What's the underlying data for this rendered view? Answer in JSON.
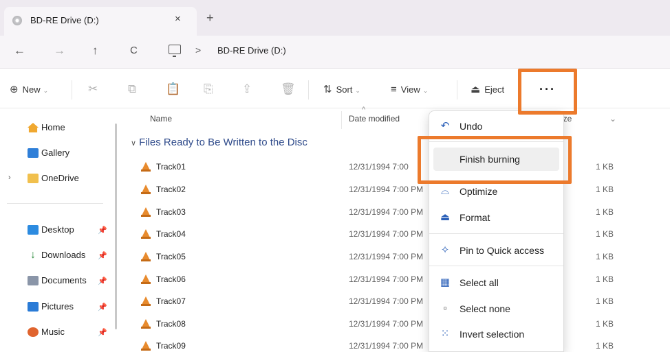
{
  "tab": {
    "title": "BD-RE Drive (D:)",
    "close_icon": "×",
    "new_tab_icon": "+"
  },
  "nav": {
    "back": "←",
    "forward": "→",
    "up": "↑",
    "refresh": "C",
    "separator": ">",
    "path": "BD-RE Drive (D:)"
  },
  "toolbar": {
    "new_label": "New",
    "sort_label": "Sort",
    "view_label": "View",
    "eject_label": "Eject",
    "more_label": "···"
  },
  "sidebar": {
    "items": [
      {
        "label": "Home"
      },
      {
        "label": "Gallery"
      },
      {
        "label": "OneDrive"
      },
      {
        "label": "Desktop"
      },
      {
        "label": "Downloads"
      },
      {
        "label": "Documents"
      },
      {
        "label": "Pictures"
      },
      {
        "label": "Music"
      }
    ]
  },
  "columns": {
    "name": "Name",
    "date": "Date modified",
    "size": "ize"
  },
  "group_label": "Files Ready to Be Written to the Disc",
  "files": [
    {
      "name": "Track01",
      "date": "12/31/1994 7:00 ",
      "size": "1 KB"
    },
    {
      "name": "Track02",
      "date": "12/31/1994 7:00 PM",
      "size": "1 KB"
    },
    {
      "name": "Track03",
      "date": "12/31/1994 7:00 PM",
      "size": "1 KB"
    },
    {
      "name": "Track04",
      "date": "12/31/1994 7:00 PM",
      "size": "1 KB"
    },
    {
      "name": "Track05",
      "date": "12/31/1994 7:00 PM",
      "size": "1 KB"
    },
    {
      "name": "Track06",
      "date": "12/31/1994 7:00 PM",
      "size": "1 KB"
    },
    {
      "name": "Track07",
      "date": "12/31/1994 7:00 PM",
      "size": "1 KB"
    },
    {
      "name": "Track08",
      "date": "12/31/1994 7:00 PM",
      "size": "1 KB"
    },
    {
      "name": "Track09",
      "date": "12/31/1994 7:00 PM",
      "size": "1 KB"
    }
  ],
  "menu": {
    "items": [
      {
        "label": "Undo",
        "icon": "undo-icon"
      },
      {
        "label": "Finish burning",
        "icon": ""
      },
      {
        "label": "Optimize",
        "icon": "optimize-icon"
      },
      {
        "label": "Format",
        "icon": "format-icon"
      },
      {
        "label": "Pin to Quick access",
        "icon": "pin-icon"
      },
      {
        "label": "Select all",
        "icon": "select-all-icon"
      },
      {
        "label": "Select none",
        "icon": "select-none-icon"
      },
      {
        "label": "Invert selection",
        "icon": "invert-selection-icon"
      }
    ]
  },
  "colors": {
    "highlight": "#ec7a2c",
    "group_text": "#2e4a8a",
    "accent_icon": "#2a5fb8"
  }
}
